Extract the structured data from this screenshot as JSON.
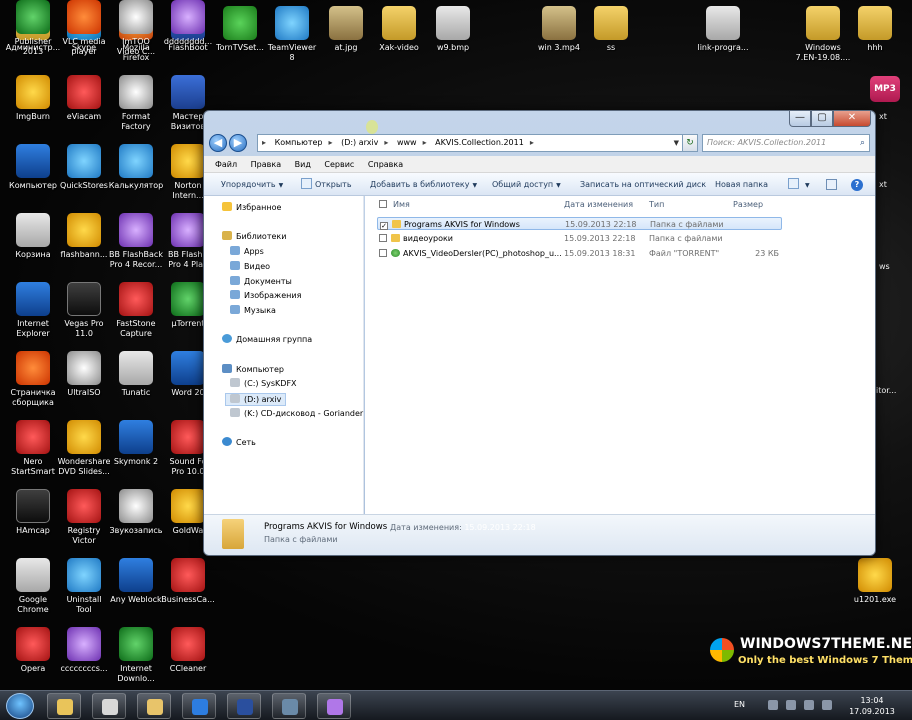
{
  "desktop_icons_left": [
    {
      "label": "Администр...",
      "icon": "user-folder-icon",
      "color": "c0"
    },
    {
      "label": "Skype",
      "icon": "skype-icon",
      "color": "c1"
    },
    {
      "label": "Mozilla\nFirefox",
      "icon": "firefox-icon",
      "color": "c2"
    },
    {
      "label": "FlashBoot",
      "icon": "flashboot-icon",
      "color": "c3"
    },
    {
      "label": "TornTVSet...",
      "icon": "shield-check-icon",
      "color": "c4"
    },
    {
      "label": "TeamViewer\n8",
      "icon": "teamviewer-icon",
      "color": "c5"
    },
    {
      "label": "at.jpg",
      "icon": "image-horse-icon",
      "color": "c6"
    },
    {
      "label": "Xak-video",
      "icon": "folder-icon",
      "color": "c0"
    },
    {
      "label": "w9.bmp",
      "icon": "bitmap-icon",
      "color": "c7"
    },
    {
      "label": "ImgBurn",
      "icon": "imgburn-disc-icon",
      "color": "c12"
    },
    {
      "label": "eViacam",
      "icon": "eviacam-icon",
      "color": "c8"
    },
    {
      "label": "Format\nFactory",
      "icon": "format-factory-icon",
      "color": "c10"
    },
    {
      "label": "Мастер\nВизитов",
      "icon": "card-master-icon",
      "color": "c3"
    },
    {
      "label": "Компьютер",
      "icon": "computer-icon",
      "color": "c11"
    },
    {
      "label": "QuickStores",
      "icon": "quickstores-icon",
      "color": "c5"
    },
    {
      "label": "Калькулятор",
      "icon": "calculator-icon",
      "color": "c5"
    },
    {
      "label": "Norton\nIntern...",
      "icon": "norton-globe-icon",
      "color": "c12"
    },
    {
      "label": "Корзина",
      "icon": "recycle-bin-icon",
      "color": "c7"
    },
    {
      "label": "flashbann...",
      "icon": "flashbanner-icon",
      "color": "c12"
    },
    {
      "label": "BB FlashBack\nPro 4 Recor...",
      "icon": "bb-flashback-recorder-icon",
      "color": "c9"
    },
    {
      "label": "BB FlashB\nPro 4 Play",
      "icon": "bb-flashback-player-icon",
      "color": "c9"
    },
    {
      "label": "Internet\nExplorer",
      "icon": "internet-explorer-icon",
      "color": "c11"
    },
    {
      "label": "Vegas Pro\n11.0",
      "icon": "vegas-pro-icon",
      "color": "c14"
    },
    {
      "label": "FastStone\nCapture",
      "icon": "faststone-capture-icon",
      "color": "c8"
    },
    {
      "label": "µTorrent",
      "icon": "utorrent-icon",
      "color": "c13"
    },
    {
      "label": "Страничка\nсборщика",
      "icon": "basketball-icon",
      "color": "c15"
    },
    {
      "label": "UltraISO",
      "icon": "ultraiso-disc-icon",
      "color": "c10"
    },
    {
      "label": "Tunatic",
      "icon": "music-note-icon",
      "color": "c7"
    },
    {
      "label": "Word 20",
      "icon": "word-icon",
      "color": "c11"
    },
    {
      "label": "Nero\nStartSmart",
      "icon": "nero-icon",
      "color": "c8"
    },
    {
      "label": "Wondershare\nDVD Slides...",
      "icon": "wondershare-icon",
      "color": "c12"
    },
    {
      "label": "Skymonk 2",
      "icon": "skymonk-icon",
      "color": "c11"
    },
    {
      "label": "Sound Fo\nPro 10.0",
      "icon": "sound-forge-icon",
      "color": "c8"
    },
    {
      "label": "HAmcap",
      "icon": "hamcap-icon",
      "color": "c14"
    },
    {
      "label": "Registry\nVictor",
      "icon": "registry-victor-icon",
      "color": "c8"
    },
    {
      "label": "Звукозапись",
      "icon": "microphone-icon",
      "color": "c10"
    },
    {
      "label": "GoldWa",
      "icon": "goldwave-icon",
      "color": "c12"
    },
    {
      "label": "Google\nChrome",
      "icon": "google-chrome-icon",
      "color": "c7"
    },
    {
      "label": "Uninstall\nTool",
      "icon": "uninstall-tool-icon",
      "color": "c5"
    },
    {
      "label": "Any Weblock",
      "icon": "any-weblock-icon",
      "color": "c11"
    },
    {
      "label": "BusinessCa...",
      "icon": "business-card-icon",
      "color": "c8"
    },
    {
      "label": "Opera",
      "icon": "opera-icon",
      "color": "c8"
    },
    {
      "label": "ccccccccs...",
      "icon": "bb-flashback-icon",
      "color": "c9"
    },
    {
      "label": "Internet\nDownlo...",
      "icon": "internet-download-manager-icon",
      "color": "c13"
    },
    {
      "label": "CCleaner",
      "icon": "ccleaner-icon",
      "color": "c8"
    },
    {
      "label": "Publisher\n2013",
      "icon": "publisher-icon",
      "color": "c13"
    },
    {
      "label": "VLC media\nplayer",
      "icon": "vlc-cone-icon",
      "color": "c15"
    },
    {
      "label": "ImTOO\nVideo C...",
      "icon": "imtoo-video-icon",
      "color": "c10"
    },
    {
      "label": "dddddddd...",
      "icon": "bb-flashback-icon",
      "color": "c9"
    }
  ],
  "desktop_icons_right": [
    {
      "label": "win 3.mp4",
      "icon": "video-thumb-icon",
      "color": "c6"
    },
    {
      "label": "ss",
      "icon": "folder-icon",
      "color": "c0"
    },
    {
      "label": "link-progra...",
      "icon": "text-file-icon",
      "color": "c7"
    },
    {
      "label": "Windows\n7.EN-19.08....",
      "icon": "folder-icon",
      "color": "c0"
    },
    {
      "label": "hhh",
      "icon": "folder-icon",
      "color": "c0"
    },
    {
      "label": "u1201.exe",
      "icon": "installer-icon",
      "color": "c12"
    }
  ],
  "edge_labels": {
    "mp3": "MP3",
    "xt": "xt",
    "ws": "ws",
    "itor": "itor..."
  },
  "window": {
    "title_buttons": {
      "min": "—",
      "max": "▢",
      "close": "✕"
    },
    "address": {
      "crumbs": [
        "Компьютер",
        "(D:) arxiv",
        "www",
        "AKVIS.Collection.2011"
      ],
      "search_placeholder": "Поиск: AKVIS.Collection.2011"
    },
    "menu": [
      "Файл",
      "Правка",
      "Вид",
      "Сервис",
      "Справка"
    ],
    "toolbar": {
      "organize": "Упорядочить",
      "open": "Открыть",
      "add_to_library": "Добавить в библиотеку",
      "share": "Общий доступ",
      "burn": "Записать на оптический диск",
      "new_folder": "Новая папка"
    },
    "nav": {
      "favorites": "Избранное",
      "libraries": "Библиотеки",
      "lib_items": [
        "Apps",
        "Видео",
        "Документы",
        "Изображения",
        "Музыка"
      ],
      "homegroup": "Домашняя группа",
      "computer": "Компьютер",
      "drives": [
        "(C:) SysKDFX",
        "(D:) arxiv",
        "(K:) CD-дисковод - Goriander"
      ],
      "network": "Сеть"
    },
    "columns": {
      "name": "Имя",
      "date": "Дата изменения",
      "type": "Тип",
      "size": "Размер"
    },
    "files": [
      {
        "name": "Programs AKVIS for Windows",
        "date": "15.09.2013 22:18",
        "type": "Папка с файлами",
        "size": "",
        "kind": "folder",
        "selected": true
      },
      {
        "name": "видеоуроки",
        "date": "15.09.2013 22:18",
        "type": "Папка с файлами",
        "size": "",
        "kind": "folder",
        "selected": false
      },
      {
        "name": "AKVIS_VideoDersler(PC)_photoshop_u...",
        "date": "15.09.2013 18:31",
        "type": "Файл \"TORRENT\"",
        "size": "23 КБ",
        "kind": "torrent",
        "selected": false
      }
    ],
    "details": {
      "name": "Programs AKVIS for Windows",
      "modified_label": "Дата изменения:",
      "modified_value": "15.09.2013 22:18",
      "type": "Папка с файлами"
    }
  },
  "watermark": {
    "title": "WINDOWS7THEME.NET",
    "subtitle": "Only the best Windows 7 Themes"
  },
  "taskbar": {
    "apps": [
      "explorer-icon",
      "google-chrome-icon",
      "folder-icon",
      "internet-explorer-icon",
      "photoshop-icon",
      "network-icon",
      "bb-flashback-icon"
    ],
    "language": "EN",
    "time": "13:04",
    "date": "17.09.2013"
  }
}
